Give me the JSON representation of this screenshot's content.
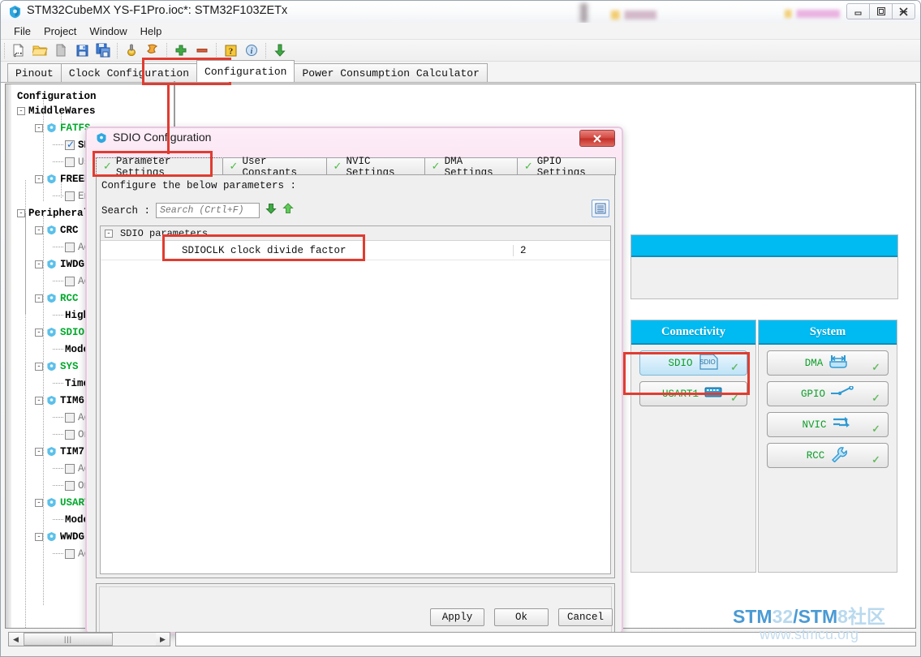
{
  "window": {
    "title": "STM32CubeMX YS-F1Pro.ioc*: STM32F103ZETx",
    "icon": "cube-icon",
    "controls": {
      "minimize": "—",
      "maximize": "❐",
      "close": "✕"
    }
  },
  "menubar": {
    "items": [
      "File",
      "Project",
      "Window",
      "Help"
    ]
  },
  "toolbar": {
    "buttons": [
      {
        "name": "new-project-icon",
        "title": "New Project"
      },
      {
        "name": "open-project-icon",
        "title": "Open Project"
      },
      {
        "name": "save-copy-icon",
        "title": "Save Project As"
      },
      {
        "name": "save-icon",
        "title": "Save Project"
      },
      {
        "name": "save-all-icon",
        "title": "Save All"
      },
      {
        "name": "generate-code-icon",
        "title": "Generate Code"
      },
      {
        "name": "generate-report-icon",
        "title": "Generate Report"
      },
      {
        "name": "zoom-in-icon",
        "title": "Zoom In"
      },
      {
        "name": "zoom-out-icon",
        "title": "Zoom Out"
      },
      {
        "name": "help-icon",
        "title": "Help"
      },
      {
        "name": "about-icon",
        "title": "About"
      },
      {
        "name": "update-icon",
        "title": "Check Update"
      }
    ]
  },
  "tabs": {
    "items": [
      "Pinout",
      "Clock Configuration",
      "Configuration",
      "Power Consumption Calculator"
    ],
    "active": "Configuration"
  },
  "tree": {
    "root_label": "Configuration",
    "nodes": [
      {
        "label": "MiddleWares",
        "style": "plain",
        "indent": 0,
        "expander": "-",
        "icon": "none",
        "checkbox": "none"
      },
      {
        "label": "FATFS",
        "style": "green",
        "indent": 1,
        "expander": "-",
        "icon": "cube-icon",
        "checkbox": "none"
      },
      {
        "label": "SD",
        "style": "plain",
        "indent": 2,
        "expander": "none",
        "icon": "none",
        "checkbox": "checked"
      },
      {
        "label": "Us",
        "style": "gray",
        "indent": 2,
        "expander": "none",
        "icon": "none",
        "checkbox": "unchecked"
      },
      {
        "label": "FREER",
        "style": "plain",
        "indent": 1,
        "expander": "-",
        "icon": "cube-icon",
        "checkbox": "none"
      },
      {
        "label": "En",
        "style": "gray",
        "indent": 2,
        "expander": "none",
        "icon": "none",
        "checkbox": "unchecked"
      },
      {
        "label": "Peripheral",
        "style": "plain",
        "indent": 0,
        "expander": "-",
        "icon": "none",
        "checkbox": "none"
      },
      {
        "label": "CRC",
        "style": "plain",
        "indent": 1,
        "expander": "-",
        "icon": "cube-icon",
        "checkbox": "none"
      },
      {
        "label": "Ac",
        "style": "gray",
        "indent": 2,
        "expander": "none",
        "icon": "none",
        "checkbox": "unchecked"
      },
      {
        "label": "IWDG",
        "style": "plain",
        "indent": 1,
        "expander": "-",
        "icon": "cube-icon",
        "checkbox": "none"
      },
      {
        "label": "Ac",
        "style": "gray",
        "indent": 2,
        "expander": "none",
        "icon": "none",
        "checkbox": "unchecked"
      },
      {
        "label": "RCC",
        "style": "green",
        "indent": 1,
        "expander": "-",
        "icon": "cube-icon",
        "checkbox": "none"
      },
      {
        "label": "High",
        "style": "plain",
        "indent": 2,
        "expander": "none",
        "icon": "none",
        "checkbox": "none"
      },
      {
        "label": "SDIO",
        "style": "green",
        "indent": 1,
        "expander": "-",
        "icon": "cube-icon",
        "checkbox": "none"
      },
      {
        "label": "Mode",
        "style": "plain",
        "indent": 2,
        "expander": "none",
        "icon": "none",
        "checkbox": "none"
      },
      {
        "label": "SYS",
        "style": "green",
        "indent": 1,
        "expander": "-",
        "icon": "cube-icon",
        "checkbox": "none"
      },
      {
        "label": "Timel",
        "style": "plain",
        "indent": 2,
        "expander": "none",
        "icon": "none",
        "checkbox": "none"
      },
      {
        "label": "TIM6",
        "style": "plain",
        "indent": 1,
        "expander": "-",
        "icon": "cube-icon",
        "checkbox": "none"
      },
      {
        "label": "Ac",
        "style": "gray",
        "indent": 2,
        "expander": "none",
        "icon": "none",
        "checkbox": "unchecked"
      },
      {
        "label": "On",
        "style": "gray",
        "indent": 2,
        "expander": "none",
        "icon": "none",
        "checkbox": "unchecked"
      },
      {
        "label": "TIM7",
        "style": "plain",
        "indent": 1,
        "expander": "-",
        "icon": "cube-icon",
        "checkbox": "none"
      },
      {
        "label": "Ac",
        "style": "gray",
        "indent": 2,
        "expander": "none",
        "icon": "none",
        "checkbox": "unchecked"
      },
      {
        "label": "On",
        "style": "gray",
        "indent": 2,
        "expander": "none",
        "icon": "none",
        "checkbox": "unchecked"
      },
      {
        "label": "USART",
        "style": "green",
        "indent": 1,
        "expander": "-",
        "icon": "cube-icon",
        "checkbox": "none"
      },
      {
        "label": "Mode",
        "style": "plain",
        "indent": 2,
        "expander": "none",
        "icon": "none",
        "checkbox": "none"
      },
      {
        "label": "WWDG",
        "style": "plain",
        "indent": 1,
        "expander": "-",
        "icon": "cube-icon",
        "checkbox": "none"
      },
      {
        "label": "Ac",
        "style": "gray",
        "indent": 2,
        "expander": "none",
        "icon": "none",
        "checkbox": "unchecked"
      }
    ]
  },
  "ip_panels": [
    {
      "title": "Connectivity",
      "items": [
        {
          "label": "SDIO",
          "icon": "sdio-card-icon",
          "selected": true,
          "configured": true
        },
        {
          "label": "USART1",
          "icon": "usart-serial-icon",
          "selected": false,
          "configured": true
        }
      ]
    },
    {
      "title": "System",
      "items": [
        {
          "label": "DMA",
          "icon": "dma-arrows-icon",
          "selected": false,
          "configured": true
        },
        {
          "label": "GPIO",
          "icon": "gpio-switch-icon",
          "selected": false,
          "configured": true
        },
        {
          "label": "NVIC",
          "icon": "nvic-arrows-icon",
          "selected": false,
          "configured": true
        },
        {
          "label": "RCC",
          "icon": "rcc-wrench-icon",
          "selected": false,
          "configured": true
        }
      ]
    }
  ],
  "dialog": {
    "title": "SDIO Configuration",
    "icon": "cube-icon",
    "close_label": "✕",
    "tabs": [
      {
        "label": "Parameter Settings",
        "active": true
      },
      {
        "label": "User Constants",
        "active": false
      },
      {
        "label": "NVIC Settings",
        "active": false
      },
      {
        "label": "DMA Settings",
        "active": false
      },
      {
        "label": "GPIO Settings",
        "active": false
      }
    ],
    "configure_note": "Configure the below parameters :",
    "search": {
      "label": "Search :",
      "value": "",
      "placeholder": "Search (Crtl+F)"
    },
    "search_down_icon": "arrow-down-icon",
    "search_up_icon": "arrow-up-icon",
    "list_view_icon": "list-view-icon",
    "groups": [
      {
        "name": "SDIO parameters",
        "expander": "-",
        "rows": [
          {
            "name": "SDIOCLK clock divide factor",
            "value": "2"
          }
        ]
      }
    ],
    "buttons": [
      {
        "label": "Apply",
        "name": "apply-button"
      },
      {
        "label": "Ok",
        "name": "ok-button"
      },
      {
        "label": "Cancel",
        "name": "cancel-button"
      }
    ]
  },
  "watermark": {
    "line1_bold1": "STM",
    "line1_light1": "32",
    "line1_bold2": "/STM",
    "line1_light2": "8",
    "line1_cjk": "社区",
    "line2": "www.stmcu.org"
  },
  "scrollbar": {
    "left_arrow": "◀",
    "right_arrow": "▶",
    "grip": "|||"
  },
  "colors": {
    "accent_blue": "#00baf2",
    "annotation_red": "#e03c31",
    "ip_green": "#0c9e28",
    "tree_green": "#00a92b",
    "dialog_pink": "#fdeef8"
  }
}
